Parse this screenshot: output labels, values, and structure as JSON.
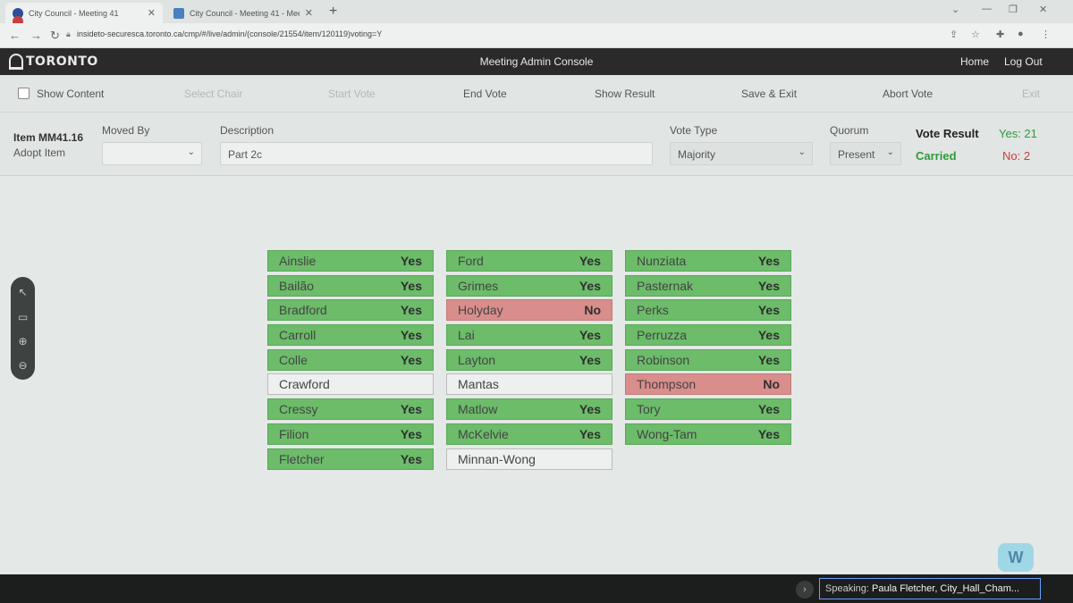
{
  "browser": {
    "tabs": [
      {
        "title": "City Council - Meeting 41"
      },
      {
        "title": "City Council - Meeting 41 - Mee"
      }
    ],
    "url": "insideto-securesca.toronto.ca/cmp/#/live/admin/(console/21554/item/120119)voting=Y"
  },
  "header": {
    "logo_text": "TORONTO",
    "title": "Meeting Admin Console",
    "home_label": "Home",
    "logout_label": "Log Out"
  },
  "toolbar": {
    "show_content": "Show Content",
    "select_chair": "Select Chair",
    "start_vote": "Start Vote",
    "end_vote": "End Vote",
    "show_result": "Show Result",
    "save_exit": "Save & Exit",
    "abort_vote": "Abort Vote",
    "exit": "Exit"
  },
  "item": {
    "id_label": "Item MM41.16",
    "action": "Adopt Item",
    "moved_by_label": "Moved By",
    "moved_by_value": "",
    "description_label": "Description",
    "description_value": "Part 2c",
    "vote_type_label": "Vote Type",
    "vote_type_value": "Majority",
    "quorum_label": "Quorum",
    "quorum_value": "Present",
    "vote_result_label": "Vote Result",
    "vote_result_status": "Carried",
    "yes_text": "Yes: 21",
    "no_text": "No: 2"
  },
  "colors": {
    "yes": "#6cbc6a",
    "no": "#d98e8b",
    "none": "#eef0ef",
    "carried": "#2f9a3a",
    "no_count": "#d23a3a"
  },
  "votes": {
    "columns": [
      [
        {
          "name": "Ainslie",
          "vote": "Yes"
        },
        {
          "name": "Bailão",
          "vote": "Yes"
        },
        {
          "name": "Bradford",
          "vote": "Yes"
        },
        {
          "name": "Carroll",
          "vote": "Yes"
        },
        {
          "name": "Colle",
          "vote": "Yes"
        },
        {
          "name": "Crawford",
          "vote": ""
        },
        {
          "name": "Cressy",
          "vote": "Yes"
        },
        {
          "name": "Filion",
          "vote": "Yes"
        },
        {
          "name": "Fletcher",
          "vote": "Yes"
        }
      ],
      [
        {
          "name": "Ford",
          "vote": "Yes"
        },
        {
          "name": "Grimes",
          "vote": "Yes"
        },
        {
          "name": "Holyday",
          "vote": "No"
        },
        {
          "name": "Lai",
          "vote": "Yes"
        },
        {
          "name": "Layton",
          "vote": "Yes"
        },
        {
          "name": "Mantas",
          "vote": ""
        },
        {
          "name": "Matlow",
          "vote": "Yes"
        },
        {
          "name": "McKelvie",
          "vote": "Yes"
        },
        {
          "name": "Minnan-Wong",
          "vote": ""
        }
      ],
      [
        {
          "name": "Nunziata",
          "vote": "Yes"
        },
        {
          "name": "Pasternak",
          "vote": "Yes"
        },
        {
          "name": "Perks",
          "vote": "Yes"
        },
        {
          "name": "Perruzza",
          "vote": "Yes"
        },
        {
          "name": "Robinson",
          "vote": "Yes"
        },
        {
          "name": "Thompson",
          "vote": "No"
        },
        {
          "name": "Tory",
          "vote": "Yes"
        },
        {
          "name": "Wong-Tam",
          "vote": "Yes"
        }
      ]
    ]
  },
  "footer": {
    "speaking_label": "Speaking:",
    "speaking_value": "Paula Fletcher, City_Hall_Cham..."
  }
}
